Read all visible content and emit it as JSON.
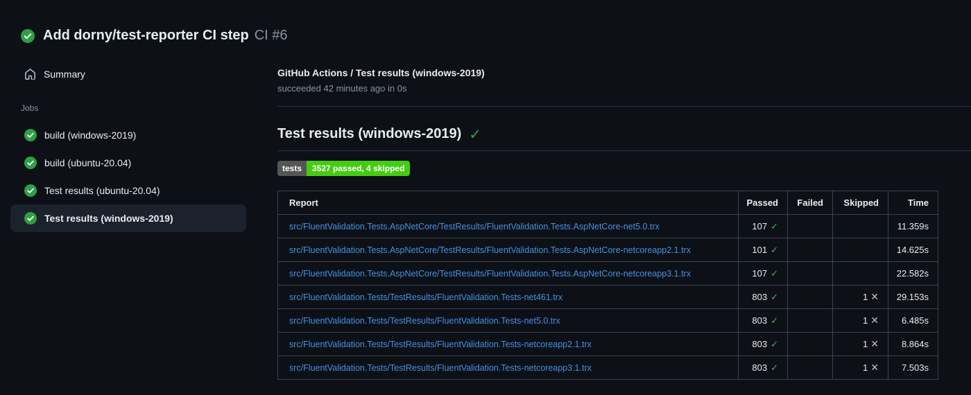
{
  "header": {
    "title": "Add dorny/test-reporter CI step",
    "run_number": "CI #6",
    "status": "success"
  },
  "sidebar": {
    "summary_label": "Summary",
    "jobs_section_label": "Jobs",
    "jobs": [
      {
        "label": "build (windows-2019)",
        "status": "success",
        "selected": false
      },
      {
        "label": "build (ubuntu-20.04)",
        "status": "success",
        "selected": false
      },
      {
        "label": "Test results (ubuntu-20.04)",
        "status": "success",
        "selected": false
      },
      {
        "label": "Test results (windows-2019)",
        "status": "success",
        "selected": true
      }
    ]
  },
  "main": {
    "job_title": "GitHub Actions / Test results (windows-2019)",
    "job_status_line": "succeeded 42 minutes ago in 0s",
    "section_heading": "Test results (windows-2019)",
    "badge": {
      "label": "tests",
      "value": "3527 passed, 4 skipped"
    },
    "table": {
      "columns": [
        "Report",
        "Passed",
        "Failed",
        "Skipped",
        "Time"
      ],
      "rows": [
        {
          "report": "src/FluentValidation.Tests.AspNetCore/TestResults/FluentValidation.Tests.AspNetCore-net5.0.trx",
          "passed": "107",
          "failed": "",
          "skipped": "",
          "time": "11.359s"
        },
        {
          "report": "src/FluentValidation.Tests.AspNetCore/TestResults/FluentValidation.Tests.AspNetCore-netcoreapp2.1.trx",
          "passed": "101",
          "failed": "",
          "skipped": "",
          "time": "14.625s"
        },
        {
          "report": "src/FluentValidation.Tests.AspNetCore/TestResults/FluentValidation.Tests.AspNetCore-netcoreapp3.1.trx",
          "passed": "107",
          "failed": "",
          "skipped": "",
          "time": "22.582s"
        },
        {
          "report": "src/FluentValidation.Tests/TestResults/FluentValidation.Tests-net461.trx",
          "passed": "803",
          "failed": "",
          "skipped": "1",
          "time": "29.153s"
        },
        {
          "report": "src/FluentValidation.Tests/TestResults/FluentValidation.Tests-net5.0.trx",
          "passed": "803",
          "failed": "",
          "skipped": "1",
          "time": "6.485s"
        },
        {
          "report": "src/FluentValidation.Tests/TestResults/FluentValidation.Tests-netcoreapp2.1.trx",
          "passed": "803",
          "failed": "",
          "skipped": "1",
          "time": "8.864s"
        },
        {
          "report": "src/FluentValidation.Tests/TestResults/FluentValidation.Tests-netcoreapp3.1.trx",
          "passed": "803",
          "failed": "",
          "skipped": "1",
          "time": "7.503s"
        }
      ]
    }
  },
  "icons": {
    "pass_mark": "✓",
    "skip_mark": "✕"
  },
  "colors": {
    "background": "#0d1117",
    "text_primary": "#e6edf3",
    "text_secondary": "#8b949e",
    "link": "#4590e2",
    "success_green": "#2ea043",
    "check_green": "#3fb950",
    "divider": "#2d3440",
    "table_border": "#3a434e",
    "selected_item_bg": "#1c222b",
    "badge_label_bg": "#555555",
    "badge_value_bg": "#44cc11"
  }
}
